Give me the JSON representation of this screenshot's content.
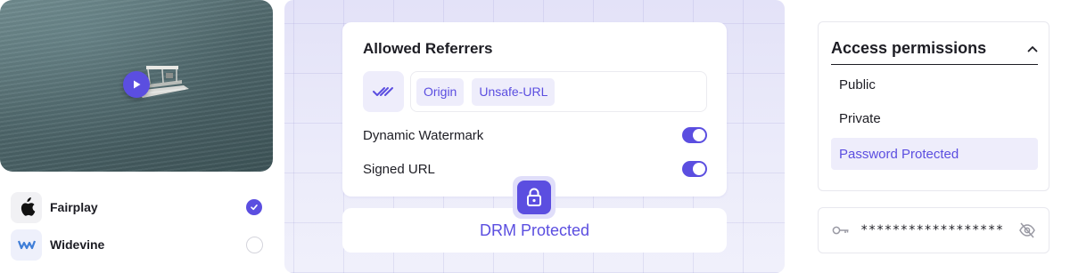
{
  "drm_options": [
    {
      "label": "Fairplay",
      "checked": true,
      "icon": "apple-icon"
    },
    {
      "label": "Widevine",
      "checked": false,
      "icon": "widevine-icon"
    }
  ],
  "referrers": {
    "title": "Allowed Referrers",
    "chips": [
      "Origin",
      "Unsafe-URL"
    ],
    "toggles": [
      {
        "label": "Dynamic Watermark",
        "on": true
      },
      {
        "label": "Signed URL",
        "on": true
      }
    ]
  },
  "drm_banner": {
    "label": "DRM Protected"
  },
  "access": {
    "title": "Access permissions",
    "options": [
      "Public",
      "Private",
      "Password Protected"
    ],
    "selected": "Password Protected"
  },
  "password": {
    "masked": "******************"
  },
  "colors": {
    "accent": "#5b4ee0",
    "accent_soft": "#eeedfb"
  }
}
